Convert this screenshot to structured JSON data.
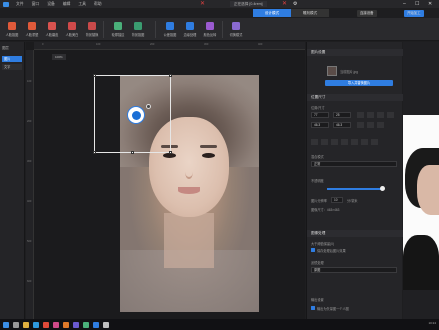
{
  "menubar": {
    "items": [
      "文件",
      "窗口",
      "设备",
      "编辑",
      "工具",
      "帮助"
    ]
  },
  "document_tab": "正在选择 [0.4rem]",
  "mode_tabs": [
    "设计模式",
    "雕刻模式"
  ],
  "top_buttons": [
    "连接设备",
    "开始加工"
  ],
  "toolbar": {
    "tools": [
      {
        "label": "人脸抠图",
        "icon": "face-cut-icon",
        "color": "#e05a3a"
      },
      {
        "label": "人脸重塑",
        "icon": "face-reshape-icon",
        "color": "#e05a3a"
      },
      {
        "label": "人脸磨皮",
        "icon": "face-smooth-icon",
        "color": "#d9534f"
      },
      {
        "label": "人脸美白",
        "icon": "face-whiten-icon",
        "color": "#d04a4a"
      },
      {
        "label": "背景替换",
        "icon": "bg-replace-icon",
        "color": "#c94a4a"
      },
      {
        "label": "轮廓描边",
        "icon": "outline-icon",
        "color": "#4ab07a"
      },
      {
        "label": "背景抠图",
        "icon": "bg-cut-icon",
        "color": "#3a9c70"
      },
      {
        "label": "公差抠图",
        "icon": "tolerance-icon",
        "color": "#2f7de1"
      },
      {
        "label": "边缘处理",
        "icon": "edge-icon",
        "color": "#2f7de1"
      },
      {
        "label": "颜色反转",
        "icon": "invert-icon",
        "color": "#9a5ad0"
      },
      {
        "label": "切换模式",
        "icon": "switch-icon",
        "color": "#8a6ad0"
      }
    ]
  },
  "left_panel": {
    "title": "图层",
    "rows": [
      "图片",
      "文字"
    ]
  },
  "canvas": {
    "zoom": "100%",
    "ruler_h": [
      "0",
      "100",
      "200",
      "300",
      "400"
    ],
    "ruler_v": [
      "100",
      "200",
      "300",
      "400",
      "500",
      "600"
    ]
  },
  "right_panel": {
    "section1": "图片设置",
    "file_label": "当前图片.jpg",
    "import_button": "导入并替换图片",
    "section2": "位置尺寸",
    "size_label": "位置/尺寸",
    "x_value": "77",
    "y_value": "25",
    "w_value": "46.3",
    "h_value": "46.3",
    "blend_label": "混合模式",
    "blend_value": "正常",
    "opacity_label": "不透明度",
    "opacity_fraction": 0.95,
    "dpi_label": "图片分辨率",
    "dpi_value": "10",
    "dpi_unit": "分/毫米",
    "resolution_note": "图像尺寸：463×463",
    "section3": "图像处理",
    "mode_label": "大于阈值保留(0)",
    "check1": "保存处理后图片效果",
    "filter_label": "滤镜处理",
    "filter_value": "原图",
    "output_label": "输出设置",
    "check2": "输出为矢量图一个人图"
  },
  "taskbar": {
    "time": "10:24",
    "icons": [
      {
        "name": "windows-icon",
        "color": "#3a8ee6"
      },
      {
        "name": "search-icon",
        "color": "#999999"
      },
      {
        "name": "folder-icon",
        "color": "#e0b040"
      },
      {
        "name": "edge-icon",
        "color": "#2f9ae0"
      },
      {
        "name": "chrome-icon",
        "color": "#e04a3a"
      },
      {
        "name": "app-a-icon",
        "color": "#d04a8a"
      },
      {
        "name": "app-b-icon",
        "color": "#e07a2a"
      },
      {
        "name": "app-c-icon",
        "color": "#6a5ad0"
      },
      {
        "name": "app-d-icon",
        "color": "#4ab07a"
      },
      {
        "name": "app-e-icon",
        "color": "#2f7de1"
      },
      {
        "name": "app-f-icon",
        "color": "#c0c0c0"
      }
    ]
  },
  "colors": {
    "accent": "#2f7de1",
    "danger": "#e04040"
  }
}
